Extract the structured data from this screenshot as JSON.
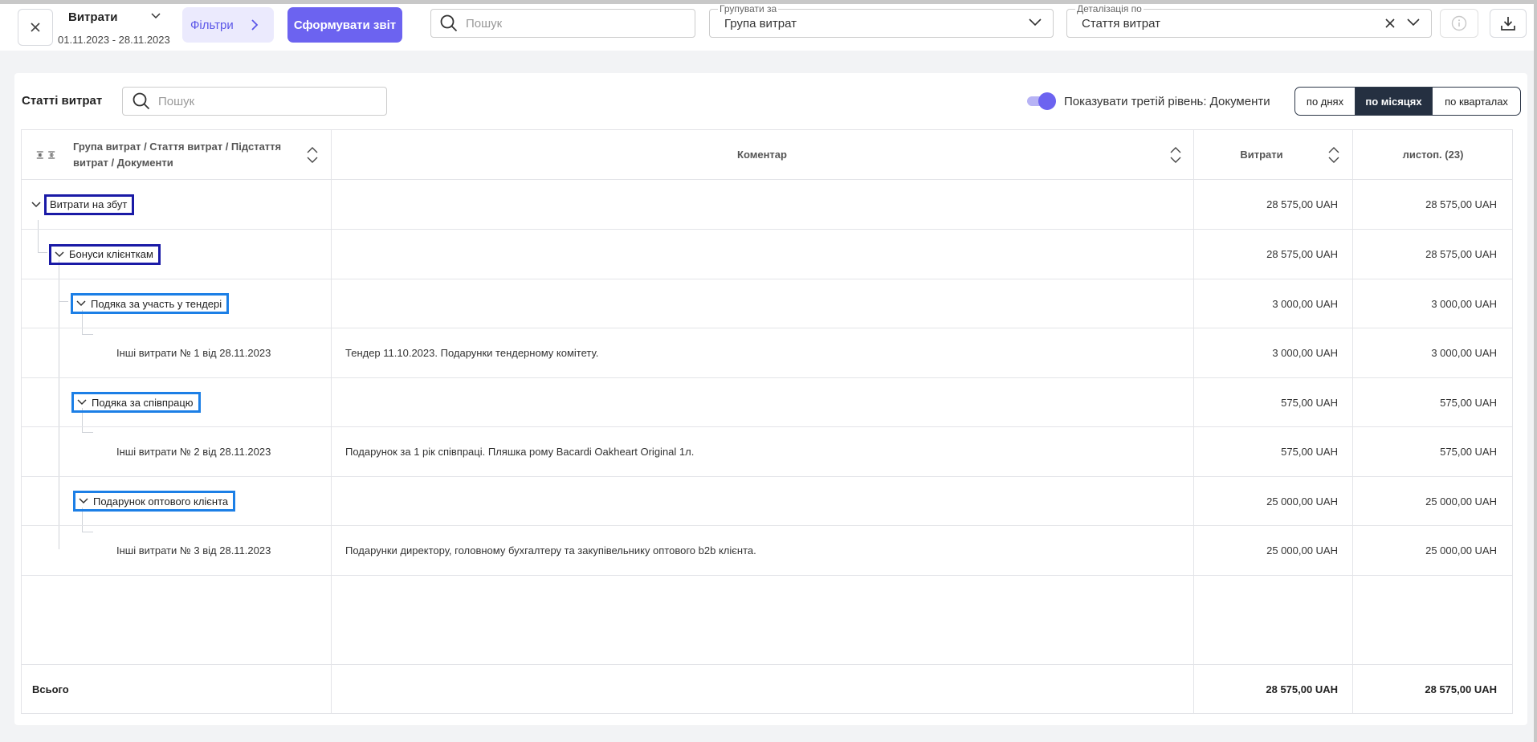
{
  "toolbar": {
    "report_title": "Витрати",
    "date_range": "01.11.2023 - 28.11.2023",
    "filters_label": "Фільтри",
    "generate_label": "Сформувати звіт",
    "search_placeholder": "Пошук",
    "group_by": {
      "label": "Групувати за",
      "value": "Група витрат"
    },
    "detail_by": {
      "label": "Деталізація по",
      "value": "Стаття витрат"
    }
  },
  "card": {
    "title": "Статті витрат",
    "search_placeholder": "Пошук",
    "toggle_label": "Показувати третій рівень: Документи",
    "toggle_on": true,
    "periods": [
      "по днях",
      "по місяцях",
      "по кварталах"
    ],
    "active_period": "по місяцях"
  },
  "table": {
    "headers": {
      "group": "Група витрат / Стаття витрат / Підстаття витрат / Документи",
      "comment": "Коментар",
      "expenses": "Витрати",
      "period": "листоп. (23)"
    },
    "rows": [
      {
        "label": "Витрати на збут",
        "comment": "",
        "expenses": "28 575,00 UAH",
        "period": "28 575,00 UAH"
      },
      {
        "label": "Бонуси клієнткам",
        "comment": "",
        "expenses": "28 575,00 UAH",
        "period": "28 575,00 UAH"
      },
      {
        "label": "Подяка за участь у тендері",
        "comment": "",
        "expenses": "3 000,00 UAH",
        "period": "3 000,00 UAH"
      },
      {
        "label": "Інші витрати № 1 від 28.11.2023",
        "comment": "Тендер 11.10.2023. Подарунки тендерному комітету.",
        "expenses": "3 000,00 UAH",
        "period": "3 000,00 UAH"
      },
      {
        "label": "Подяка за співпрацю",
        "comment": "",
        "expenses": "575,00 UAH",
        "period": "575,00 UAH"
      },
      {
        "label": "Інші витрати № 2 від 28.11.2023",
        "comment": "Подарунок за 1 рік співпраці. Пляшка рому Bacardi Oakheart Original 1л.",
        "expenses": "575,00 UAH",
        "period": "575,00 UAH"
      },
      {
        "label": "Подарунок оптового клієнта",
        "comment": "",
        "expenses": "25 000,00 UAH",
        "period": "25 000,00 UAH"
      },
      {
        "label": "Інші витрати № 3 від 28.11.2023",
        "comment": "Подарунки директору, головному бухгалтеру та закупівельнику оптового b2b клієнта.",
        "expenses": "25 000,00 UAH",
        "period": "25 000,00 UAH"
      }
    ],
    "total": {
      "label": "Всього",
      "expenses": "28 575,00 UAH",
      "period": "28 575,00 UAH"
    }
  },
  "colors": {
    "accent": "#6c63f0",
    "accent_light": "#ebeafd",
    "dark_segment": "#253041",
    "highlight_dark": "#1a1aa6",
    "highlight_light": "#1c7fe6"
  },
  "icons": [
    "close-icon",
    "chevron-down-icon",
    "chevron-right-icon",
    "search-icon",
    "info-icon",
    "download-icon",
    "expand-collapse-icon",
    "sort-icon"
  ]
}
